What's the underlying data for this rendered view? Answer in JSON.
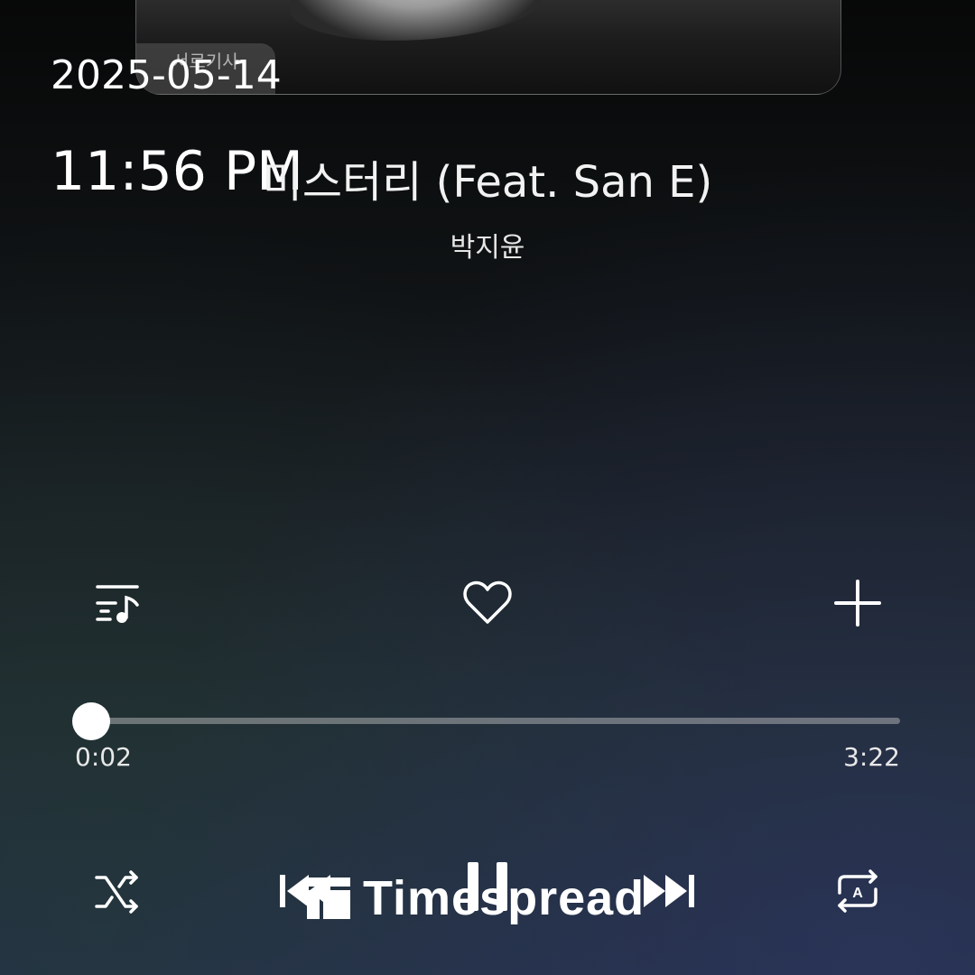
{
  "overlay": {
    "date": "2025-05-14",
    "time": "11:56 PM"
  },
  "album_card": {
    "label": "서로기사"
  },
  "track": {
    "title": "미스터리 (Feat. San E)",
    "artist": "박지윤"
  },
  "progress": {
    "current": "0:02",
    "total": "3:22",
    "fraction": 0.01
  },
  "icons": {
    "playlist": "playlist-music-icon",
    "like": "heart-outline-icon",
    "add": "plus-icon",
    "shuffle": "shuffle-icon",
    "previous": "skip-previous-icon",
    "play_pause": "pause-icon",
    "next": "skip-next-icon",
    "repeat": "repeat-auto-icon"
  },
  "watermark": {
    "text": "Timespread"
  },
  "colors": {
    "text": "#ffffff",
    "track": "#c8c8c8",
    "bg_top": "#070808",
    "bg_bottom": "#232d45"
  }
}
